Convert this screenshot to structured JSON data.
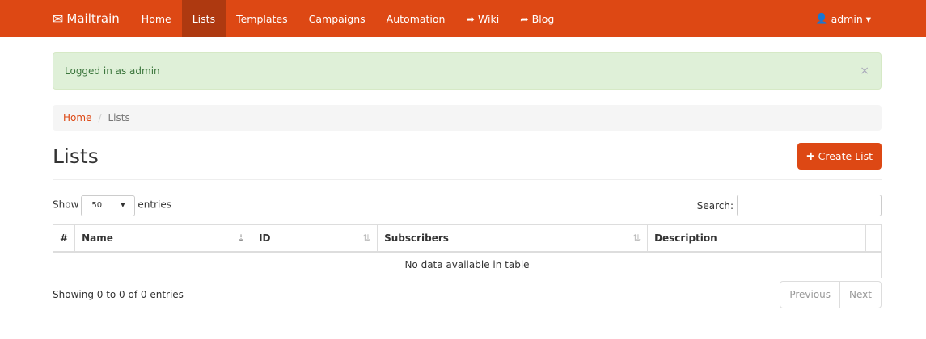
{
  "nav": {
    "brand": "Mailtrain",
    "items": [
      "Home",
      "Lists",
      "Templates",
      "Campaigns",
      "Automation",
      "Wiki",
      "Blog"
    ],
    "user": "admin"
  },
  "alert": {
    "text": "Logged in as admin",
    "close": "×"
  },
  "breadcrumb": {
    "home": "Home",
    "current": "Lists"
  },
  "page": {
    "title": "Lists",
    "create": "Create List"
  },
  "table": {
    "show": "Show",
    "entries": "entries",
    "length": "50",
    "search": "Search:",
    "columns": [
      "#",
      "Name",
      "ID",
      "Subscribers",
      "Description"
    ],
    "empty": "No data available in table",
    "info": "Showing 0 to 0 of 0 entries",
    "prev": "Previous",
    "next": "Next"
  }
}
